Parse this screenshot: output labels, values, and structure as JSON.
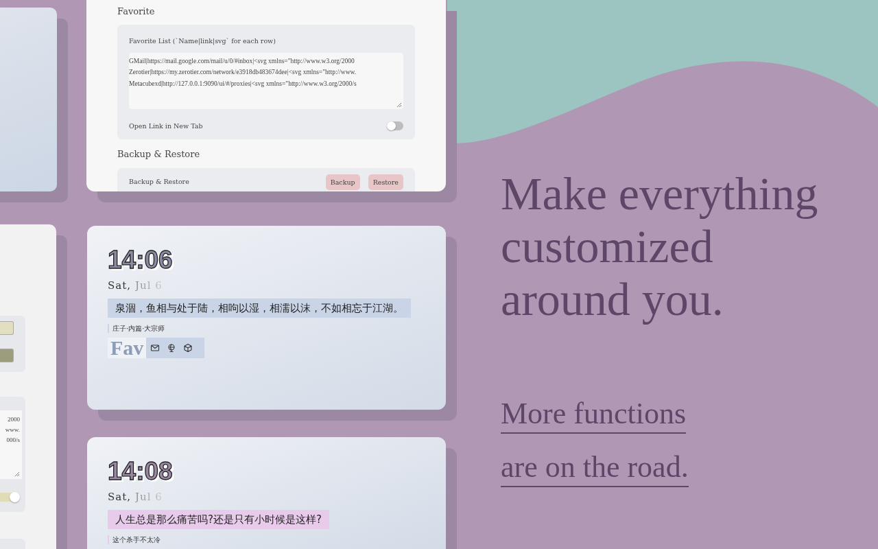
{
  "left_cards": [
    {
      "kind": "clock"
    },
    {
      "kind": "settings",
      "swatches": [
        {
          "color": "#e2dfc0"
        },
        {
          "color": "#9b9d7d"
        }
      ],
      "favorite_lines": [
        "2000",
        "www.",
        "000/s"
      ],
      "toggle_on": true
    }
  ],
  "settings_card": {
    "section_title": "Favorite",
    "favorite_label": "Favorite List (`Name|link|svg` for each row)",
    "favorite_lines": [
      "GMail|https://mail.google.com/mail/u/0/#inbox|<svg xmlns=\"http://www.w3.org/2000",
      "Zerotier|https://my.zerotier.com/network/e3918db483674dee|<svg xmlns=\"http://www.",
      "Metacubexd|http://127.0.0.1:9090/ui/#/proxies|<svg xmlns=\"http://www.w3.org/2000/s"
    ],
    "toggle_label": "Open Link in New Tab",
    "toggle_on": false,
    "backup_title": "Backup & Restore",
    "backup_label": "Backup & Restore",
    "buttons": [
      "Backup",
      "Restore"
    ]
  },
  "clock_cards": [
    {
      "time": "14:06",
      "weekday": "Sat,",
      "date": "Jul 6",
      "quote": "泉涸，鱼相与处于陆，相呴以湿，相濡以沫，不如相忘于江湖。",
      "source": "庄子·内篇·大宗师",
      "color": "#c9d4e6",
      "favorites_title": "Fav"
    },
    {
      "time": "14:08",
      "weekday": "Sat,",
      "date": "Jul 6",
      "quote": "人生总是那么痛苦吗?还是只有小时候是这样?",
      "source": "这个杀手不太冷",
      "color": "#e8cbea"
    }
  ],
  "headline": [
    "Make everything",
    "customized",
    "around you."
  ],
  "subline": [
    "More functions",
    "are on the road."
  ]
}
